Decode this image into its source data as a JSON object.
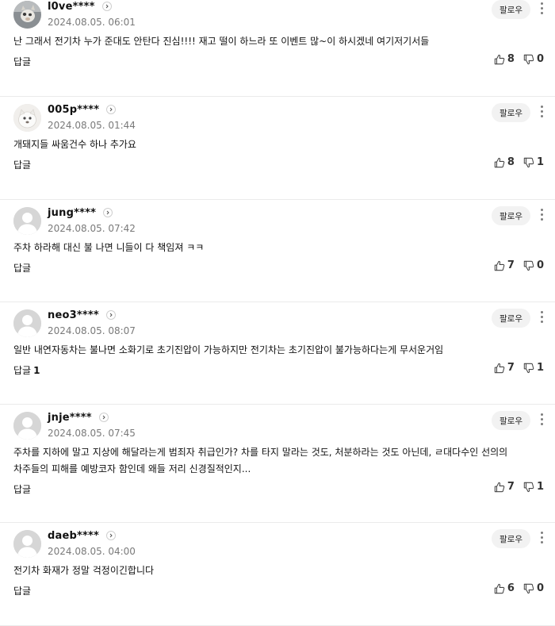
{
  "comments": [
    {
      "nickname": "l0ve****",
      "date": "2024.08.05. 06:01",
      "text": "난 그래서 전기차 누가 준대도 안탄다 진심!!!! 재고 떨이 하느라 또 이벤트 많~이 하시겠네 여기저기서들",
      "reply_label": "답글",
      "reply_count": "",
      "likes": "8",
      "dislikes": "0",
      "follow_label": "팔로우",
      "avatar": "photo"
    },
    {
      "nickname": "005p****",
      "date": "2024.08.05. 01:44",
      "text": "개돼지들 싸움건수 하나 추가요",
      "reply_label": "답글",
      "reply_count": "",
      "likes": "8",
      "dislikes": "1",
      "follow_label": "팔로우",
      "avatar": "photo-light"
    },
    {
      "nickname": "jung****",
      "date": "2024.08.05. 07:42",
      "text": "주차 하라해 대신 불 나면 니들이 다 책임져 ㅋㅋ",
      "reply_label": "답글",
      "reply_count": "",
      "likes": "7",
      "dislikes": "0",
      "follow_label": "팔로우",
      "avatar": "default"
    },
    {
      "nickname": "neo3****",
      "date": "2024.08.05. 08:07",
      "text": "일반 내연자동차는 불나면 소화기로 초기진압이 가능하지만 전기차는 초기진압이 불가능하다는게 무서운거임",
      "reply_label": "답글",
      "reply_count": "1",
      "likes": "7",
      "dislikes": "1",
      "follow_label": "팔로우",
      "avatar": "default"
    },
    {
      "nickname": "jnje****",
      "date": "2024.08.05. 07:45",
      "text": "주차를 지하에 말고 지상에 해달라는게 범죄자 취급인가? 차를 타지 말라는 것도, 처분하라는 것도 아닌데, ㄹ대다수인 선의의 차주들의 피해를 예방코자 함인데 왜들 저리 신경질적인지...",
      "reply_label": "답글",
      "reply_count": "",
      "likes": "7",
      "dislikes": "1",
      "follow_label": "팔로우",
      "avatar": "default"
    },
    {
      "nickname": "daeb****",
      "date": "2024.08.05. 04:00",
      "text": "전기차 화재가 정말 걱정이긴합니다",
      "reply_label": "답글",
      "reply_count": "",
      "likes": "6",
      "dislikes": "0",
      "follow_label": "팔로우",
      "avatar": "default"
    }
  ],
  "icons": {
    "profile_link": "chevron-right-icon",
    "like": "thumbs-up-icon",
    "dislike": "thumbs-down-icon",
    "menu": "more-vertical-icon"
  },
  "colors": {
    "date": "#7a7a7a",
    "divider": "#ebebeb",
    "follow_bg": "#f2f2f2",
    "avatar_default": "#d9d9d9"
  }
}
